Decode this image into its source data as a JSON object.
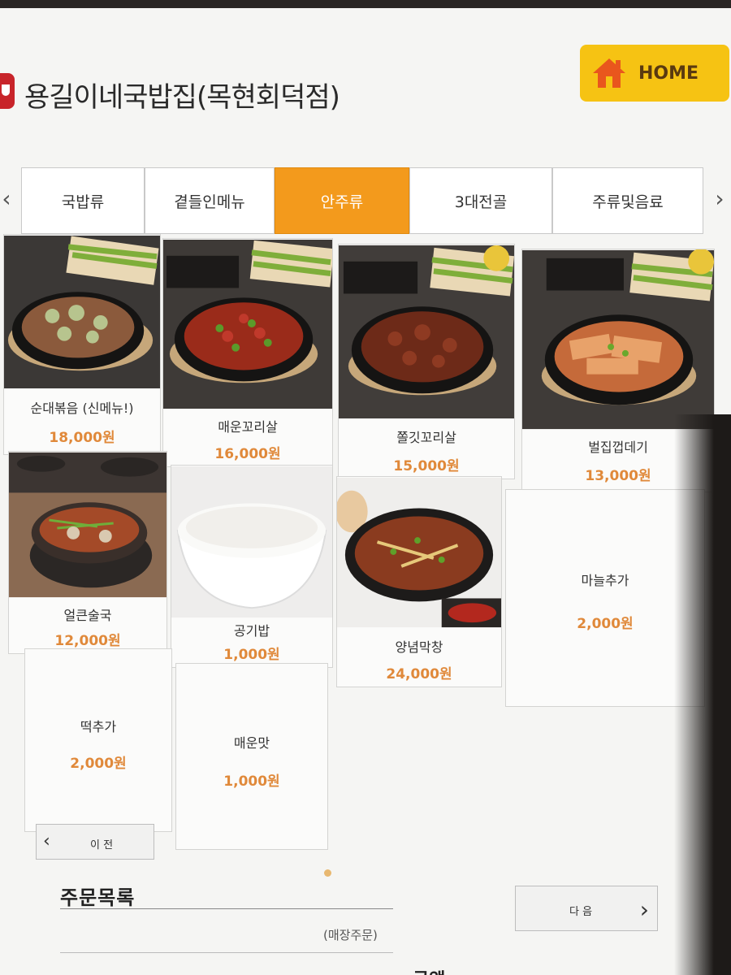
{
  "header": {
    "store_name": "용길이네국밥집(목현회덕점)",
    "home_label": "HOME"
  },
  "categories": [
    {
      "label": "국밥류",
      "active": false
    },
    {
      "label": "곁들인메뉴",
      "active": false
    },
    {
      "label": "안주류",
      "active": true
    },
    {
      "label": "3대전골",
      "active": false
    },
    {
      "label": "주류및음료",
      "active": false
    }
  ],
  "menu": [
    {
      "name": "순대볶음 (신메뉴!)",
      "price": "18,000원",
      "image": "sundae-stirfry"
    },
    {
      "name": "매운꼬리살",
      "price": "16,000원",
      "image": "spicy-tail"
    },
    {
      "name": "쫄깃꼬리살",
      "price": "15,000원",
      "image": "chewy-tail"
    },
    {
      "name": "벌집껍데기",
      "price": "13,000원",
      "image": "honeycomb-skin"
    },
    {
      "name": "얼큰술국",
      "price": "12,000원",
      "image": "spicy-soup"
    },
    {
      "name": "공기밥",
      "price": "1,000원",
      "image": "rice-bowl"
    },
    {
      "name": "양념막창",
      "price": "24,000원",
      "image": "seasoned-makchang"
    },
    {
      "name": "마늘추가",
      "price": "2,000원",
      "image": ""
    },
    {
      "name": "떡추가",
      "price": "2,000원",
      "image": ""
    },
    {
      "name": "매운맛",
      "price": "1,000원",
      "image": ""
    }
  ],
  "pagination": {
    "prev_label": "이 전",
    "next_label": "다 음"
  },
  "order": {
    "title": "주문목록",
    "type": "(매장주문)",
    "amount_label": "금액"
  },
  "colors": {
    "accent": "#f39a1c",
    "home": "#f6c313",
    "price": "#e0893a"
  }
}
